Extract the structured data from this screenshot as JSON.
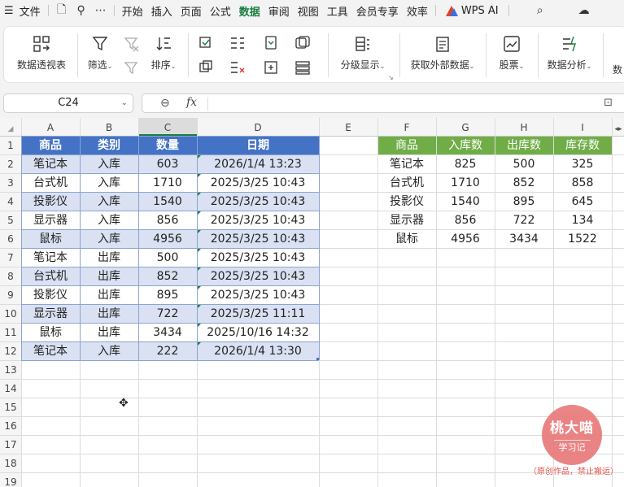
{
  "menubar": {
    "file_icon": "☰",
    "file": "文件",
    "save_icon": "🗋",
    "format_painter_icon": "⚲",
    "more_icon": "⋯",
    "items": [
      {
        "label": "开始"
      },
      {
        "label": "插入"
      },
      {
        "label": "页面"
      },
      {
        "label": "公式"
      },
      {
        "label": "数据",
        "active": true
      },
      {
        "label": "审阅"
      },
      {
        "label": "视图"
      },
      {
        "label": "工具"
      },
      {
        "label": "会员专享"
      },
      {
        "label": "效率"
      }
    ],
    "wps_ai": "WPS AI",
    "search_icon": "⌕",
    "cloud_icon": "☁"
  },
  "ribbon": {
    "pivot": "数据透视表",
    "filter": "筛选",
    "sort": "排序",
    "group": "分级显示",
    "external": "获取外部数据",
    "stocks": "股票",
    "analysis": "数据分析",
    "partial": "数",
    "drop_arrow": "⌄",
    "corner_mark": "↘"
  },
  "formula_bar": {
    "cell_ref": "C24",
    "arrow": "⌄",
    "zoom_icon": "⊖",
    "fx": "fx",
    "right_icon": "⊡",
    "value": ""
  },
  "sheet": {
    "select_all": "◢",
    "columns": [
      "A",
      "B",
      "C",
      "D",
      "E",
      "F",
      "G",
      "H",
      "I"
    ],
    "rows": [
      "1",
      "2",
      "3",
      "4",
      "5",
      "6",
      "7",
      "8",
      "9",
      "10",
      "11",
      "12",
      "13",
      "14",
      "15",
      "16",
      "17",
      "18",
      "19"
    ],
    "selected_column": "C",
    "table1": {
      "headers": [
        "商品",
        "类别",
        "数量",
        "日期"
      ],
      "rows": [
        [
          "笔记本",
          "入库",
          "603",
          "2026/1/4 13:23"
        ],
        [
          "台式机",
          "入库",
          "1710",
          "2025/3/25 10:43"
        ],
        [
          "投影仪",
          "入库",
          "1540",
          "2025/3/25 10:43"
        ],
        [
          "显示器",
          "入库",
          "856",
          "2025/3/25 10:43"
        ],
        [
          "鼠标",
          "入库",
          "4956",
          "2025/3/25 10:43"
        ],
        [
          "笔记本",
          "出库",
          "500",
          "2025/3/25 10:43"
        ],
        [
          "台式机",
          "出库",
          "852",
          "2025/3/25 10:43"
        ],
        [
          "投影仪",
          "出库",
          "895",
          "2025/3/25 10:43"
        ],
        [
          "显示器",
          "出库",
          "722",
          "2025/3/25 11:11"
        ],
        [
          "鼠标",
          "出库",
          "3434",
          "2025/10/16 14:32"
        ],
        [
          "笔记本",
          "入库",
          "222",
          "2026/1/4 13:30"
        ]
      ]
    },
    "table2": {
      "headers": [
        "商品",
        "入库数",
        "出库数",
        "库存数"
      ],
      "rows": [
        [
          "笔记本",
          "825",
          "500",
          "325"
        ],
        [
          "台式机",
          "1710",
          "852",
          "858"
        ],
        [
          "投影仪",
          "1540",
          "895",
          "645"
        ],
        [
          "显示器",
          "856",
          "722",
          "134"
        ],
        [
          "鼠标",
          "4956",
          "3434",
          "1522"
        ]
      ]
    },
    "scroll_arrows": "◂▸"
  },
  "colors": {
    "table1_header": "#4472c4",
    "table1_band": "#d9e1f2",
    "table2_header": "#70ad47",
    "active_tab": "#1a7d3f",
    "watermark": "#e97e7e"
  },
  "watermark": {
    "title": "桃大喵",
    "subtitle": "学习记",
    "note": "（原创作品，禁止搬运）"
  },
  "cursor_icon": "✥"
}
